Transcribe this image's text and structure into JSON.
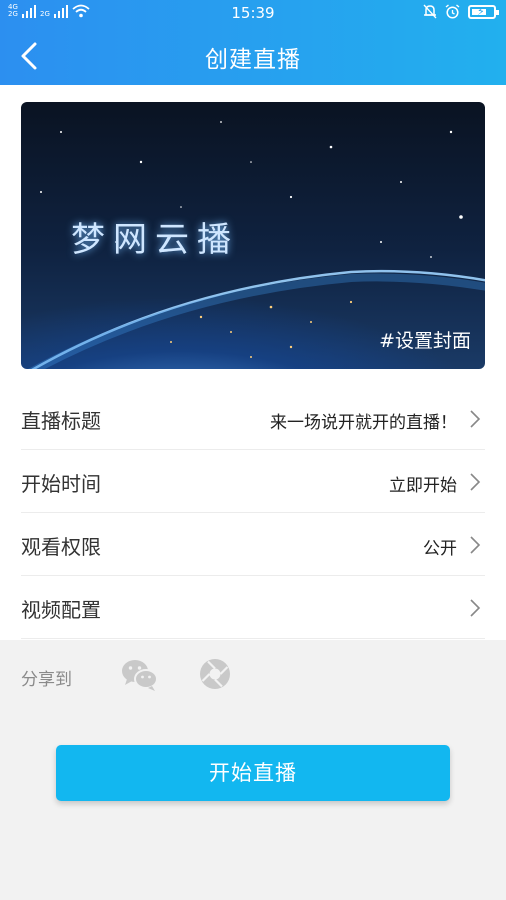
{
  "status_bar": {
    "network": [
      "4G",
      "2G"
    ],
    "network2": "2G",
    "time": "15:39"
  },
  "header": {
    "title": "创建直播"
  },
  "cover": {
    "title": "梦网云播",
    "set_cover_label": "#设置封面"
  },
  "settings": [
    {
      "label": "直播标题",
      "value": "来一场说开就开的直播！"
    },
    {
      "label": "开始时间",
      "value": "立即开始"
    },
    {
      "label": "观看权限",
      "value": "公开"
    },
    {
      "label": "视频配置",
      "value": ""
    }
  ],
  "share": {
    "label": "分享到",
    "targets": [
      "wechat-icon",
      "moments-icon"
    ]
  },
  "action": {
    "start_label": "开始直播"
  },
  "colors": {
    "accent": "#12b7f0",
    "header_start": "#2c8ff0",
    "header_end": "#22b0ee"
  }
}
